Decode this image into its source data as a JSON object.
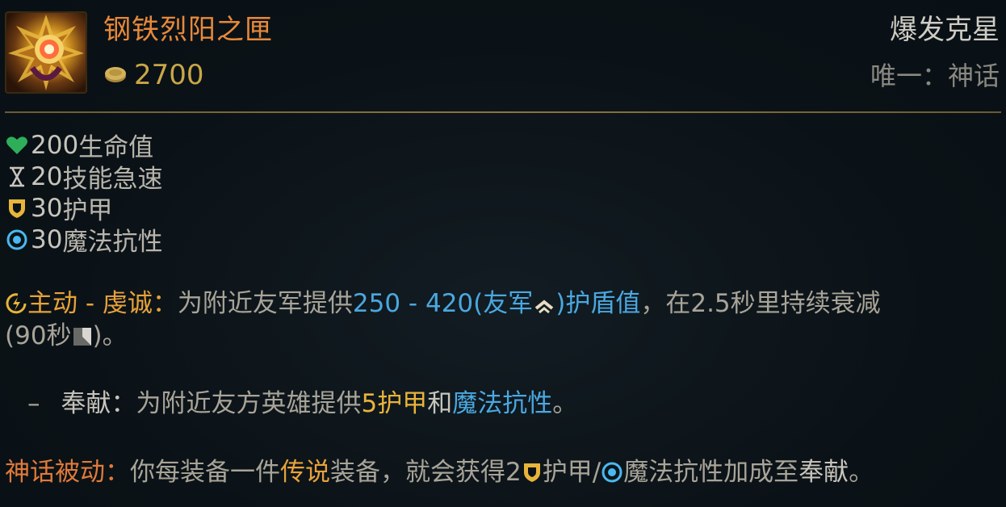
{
  "item": {
    "name": "钢铁烈阳之匣",
    "cost": "2700",
    "category": "爆发克星",
    "unique": "唯一：神话",
    "icon": "locket-of-the-iron-solari-icon"
  },
  "stats": [
    {
      "icon": "health-heart-icon",
      "value": "200",
      "label": "生命值"
    },
    {
      "icon": "ability-haste-hourglass-icon",
      "value": "20",
      "label": "技能急速"
    },
    {
      "icon": "armor-shield-icon",
      "value": "30",
      "label": "护甲"
    },
    {
      "icon": "magic-resist-icon",
      "value": "30",
      "label": "魔法抗性"
    }
  ],
  "active": {
    "label": "主动 - 虔诚：",
    "text_a": "为附近友军提供",
    "shield_value": "250 - 420(友军",
    "shield_value_b": ")护盾值",
    "text_b": "，在2.5秒里持续衰减",
    "cooldown_a": "(90秒",
    "cooldown_b": ")。"
  },
  "consecrate": {
    "dash": "–",
    "label": "奉献：",
    "text_a": "为附近友方英雄提供",
    "armor": "5护甲",
    "text_b": "和",
    "mr": "魔法抗性",
    "text_c": "。"
  },
  "mythic": {
    "label": "神话被动：",
    "text_a": "你每装备一件",
    "legendary": "传说",
    "text_b": "装备，就会获得2",
    "armor": "护甲/",
    "mr": "魔法抗性加成至",
    "consecrate": "奉献",
    "text_c": "。"
  },
  "colors": {
    "name": "#e8893a",
    "gold": "#c9a648",
    "blue": "#4aa8e0",
    "orange": "#e8a23a",
    "heart": "#2fae5a"
  }
}
